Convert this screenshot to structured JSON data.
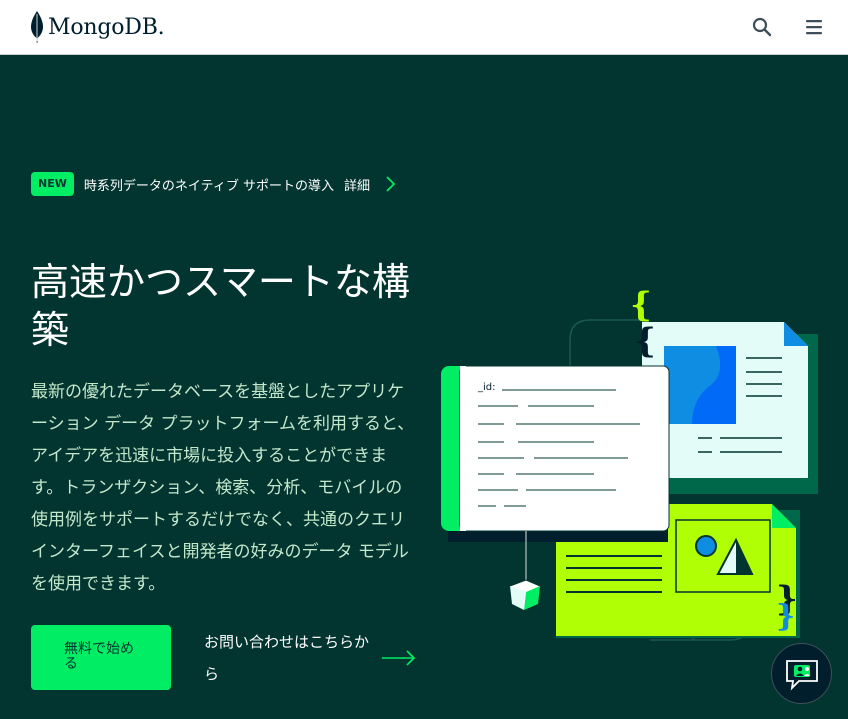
{
  "brand": {
    "name": "MongoDB."
  },
  "header": {
    "search_icon": "search-icon",
    "menu_icon": "hamburger-menu-icon"
  },
  "announcement": {
    "badge": "NEW",
    "text": "時系列データのネイティブ サポートの導入",
    "link": "詳細"
  },
  "hero": {
    "title": "高速かつスマートな構築",
    "description": "最新の優れたデータベースを基盤としたアプリケーション データ プラットフォームを利用すると、アイデアを迅速に市場に投入することができます。トランザクション、検索、分析、モバイルの使用例をサポートするだけでなく、共通のクエリ インターフェイスと開発者の好みのデータ モデルを使用できます。",
    "primary_cta": "無料で始める",
    "secondary_cta": "お問い合わせはこちらから"
  },
  "illustration": {
    "doc_field": "_id:"
  },
  "colors": {
    "bg": "#023430",
    "accent": "#00ed64",
    "lime": "#b1ff05",
    "blue": "#0e8de3",
    "light": "#e3fcf7"
  },
  "chat": {
    "icon": "chat-support-icon"
  }
}
